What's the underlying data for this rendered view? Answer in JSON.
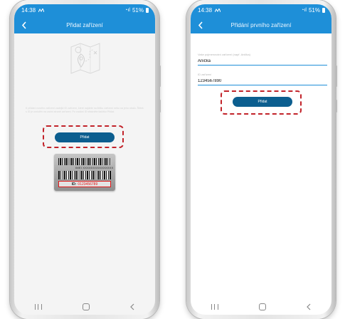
{
  "left_phone": {
    "status": {
      "time": "14:38",
      "battery": "51%"
    },
    "header": {
      "title": "Přidat zařízení"
    },
    "description": "K přidání nového zařízení zadejte ID zařízení, které najdete na štítku zařízení nebo na jeho obalu. Štítek s ID je umístěn na zadní straně zařízení. Po zadání ID stiskněte tlačítko Přidat.",
    "add_button_label": "Přidat",
    "barcode": {
      "serial": "IMEI XXXXXXXXXXXXXXX",
      "id_prefix": "ID:",
      "id_value": "0123456789"
    }
  },
  "right_phone": {
    "status": {
      "time": "14:38",
      "battery": "51%"
    },
    "header": {
      "title": "Přidání prvního zařízení"
    },
    "name_field": {
      "label": "Vaše pojmenování zařízení (např. Anička)",
      "value": "Anička"
    },
    "id_field": {
      "label": "ID zařízení",
      "value": "1234567890"
    },
    "add_button_label": "Přidat"
  },
  "colors": {
    "header": "#1e8fd8",
    "button": "#0c5e8f",
    "highlight": "#c2232a"
  },
  "icons": [
    "back-arrow",
    "map-pin",
    "barcode",
    "recent-apps",
    "home",
    "back"
  ]
}
